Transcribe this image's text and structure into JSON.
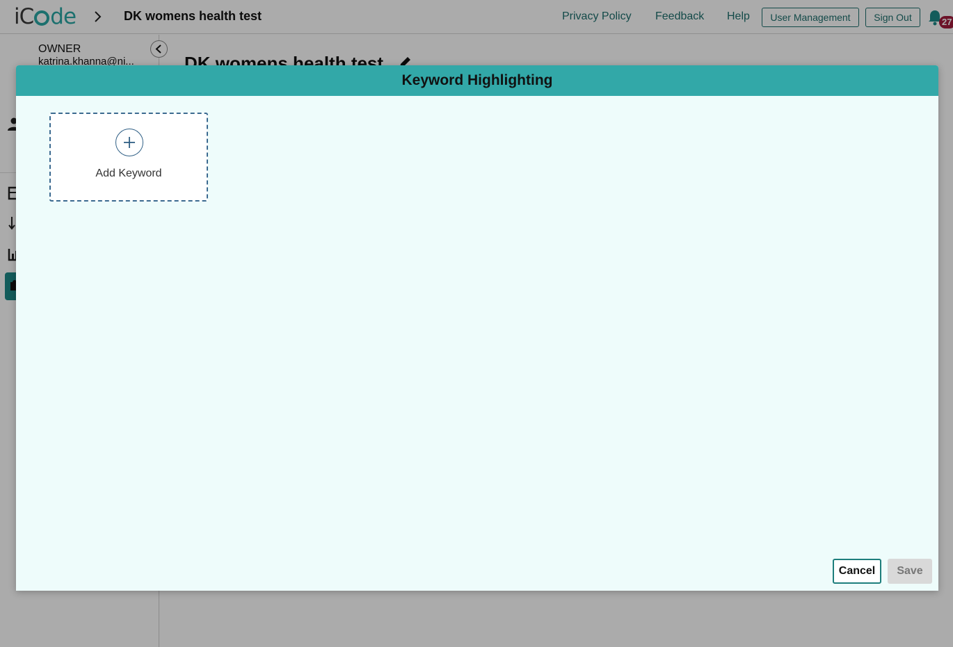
{
  "app": {
    "logo_text": "iCode",
    "project_title": "DK womens health test"
  },
  "nav": {
    "links": [
      "Privacy Policy",
      "Feedback",
      "Help"
    ],
    "user_management_label": "User Management",
    "sign_out_label": "Sign Out",
    "notification_count": "27"
  },
  "sidebar": {
    "role": "OWNER",
    "email": "katrina.khanna@ni..."
  },
  "main": {
    "heading": "DK womens health test"
  },
  "modal": {
    "title": "Keyword Highlighting",
    "add_keyword_label": "Add Keyword",
    "cancel_label": "Cancel",
    "save_label": "Save"
  },
  "colors": {
    "accent": "#32a8a8",
    "brand_teal": "#1d6f6d",
    "badge": "#a11c3c"
  },
  "icons": [
    "chevron-right-icon",
    "bell-icon",
    "chevron-left-icon",
    "user-icon",
    "calendar-icon",
    "download-icon",
    "bar-chart-icon",
    "puzzle-icon",
    "pencil-icon",
    "plus-icon"
  ]
}
